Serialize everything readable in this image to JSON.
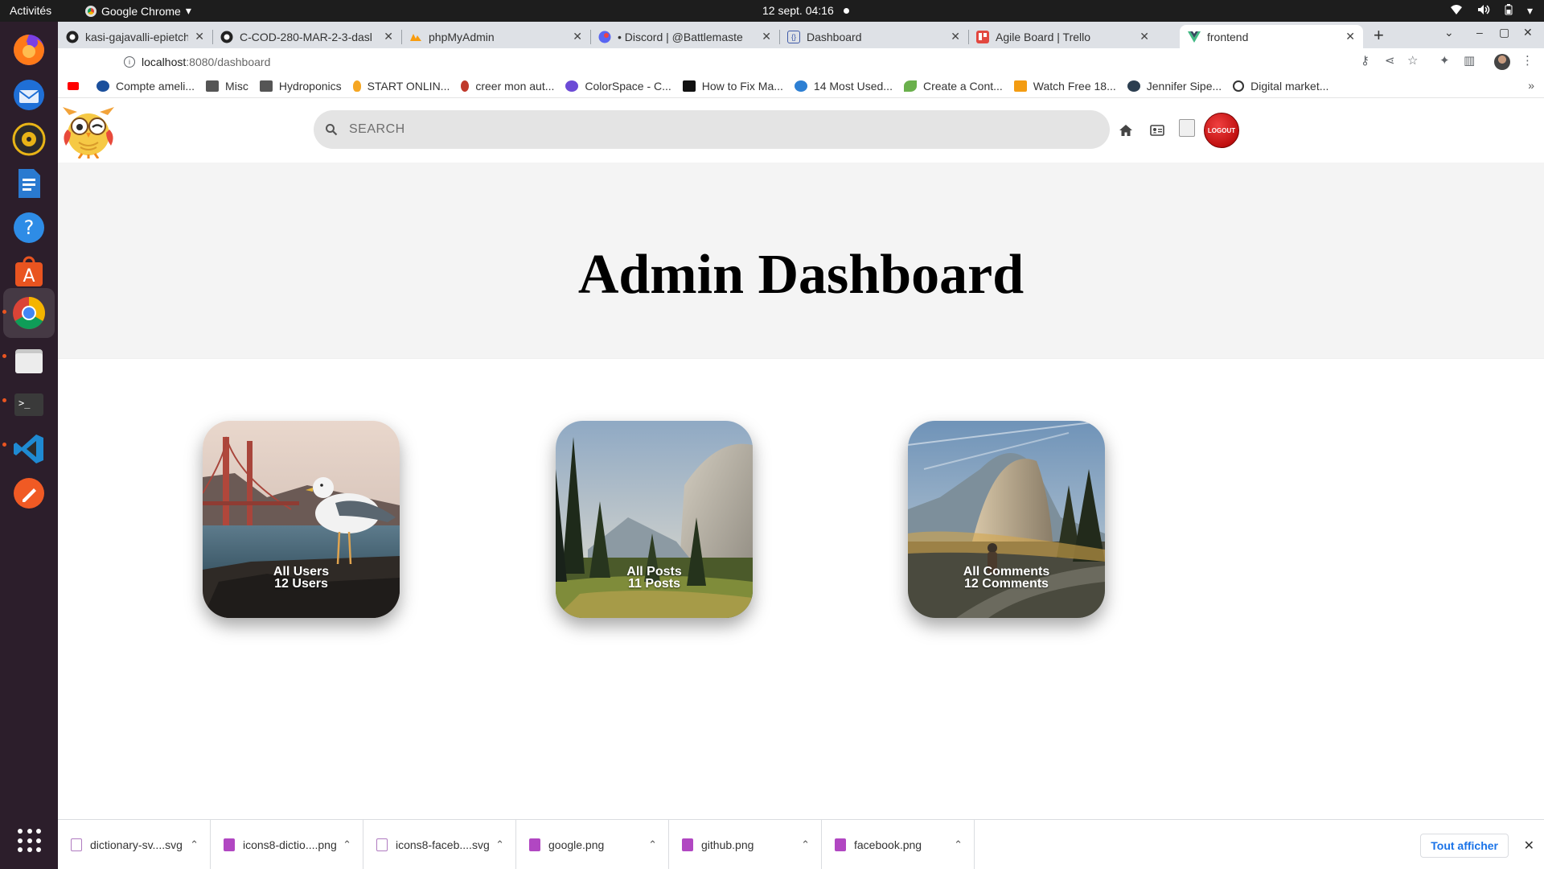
{
  "system": {
    "activities": "Activités",
    "app_menu": "Google Chrome",
    "clock": "12 sept.  04:16"
  },
  "browser": {
    "tabs": [
      {
        "title": "kasi-gajavalli-epietch/Yo",
        "icon": "github-icon"
      },
      {
        "title": "C-COD-280-MAR-2-3-dasl",
        "icon": "github-icon"
      },
      {
        "title": "phpMyAdmin",
        "icon": "phpmyadmin-icon"
      },
      {
        "title": "• Discord | @Battlemaste",
        "icon": "discord-icon"
      },
      {
        "title": "Dashboard",
        "icon": "vue-dashboard-icon"
      },
      {
        "title": "Agile Board | Trello",
        "icon": "trello-icon"
      },
      {
        "title": "frontend",
        "icon": "vue-icon"
      }
    ],
    "url_host": "localhost",
    "url_path": ":8080/dashboard",
    "bookmarks": [
      "Compte ameli...",
      "Misc",
      "Hydroponics",
      "START ONLIN...",
      "creer mon aut...",
      "ColorSpace - C...",
      "How to Fix Ma...",
      "14 Most Used...",
      "Create a Cont...",
      "Watch Free 18...",
      "Jennifer Sipe...",
      "Digital market..."
    ]
  },
  "app": {
    "search_placeholder": "SEARCH",
    "logout_label": "LOGOUT",
    "title": "Admin Dashboard",
    "cards": [
      {
        "title": "All Users",
        "count": "12 Users"
      },
      {
        "title": "All Posts",
        "count": "11 Posts"
      },
      {
        "title": "All Comments",
        "count": "12 Comments"
      }
    ]
  },
  "downloads": {
    "items": [
      {
        "name": "dictionary-sv....svg",
        "type": "svg"
      },
      {
        "name": "icons8-dictio....png",
        "type": "png"
      },
      {
        "name": "icons8-faceb....svg",
        "type": "svg"
      },
      {
        "name": "google.png",
        "type": "png"
      },
      {
        "name": "github.png",
        "type": "png"
      },
      {
        "name": "facebook.png",
        "type": "png"
      }
    ],
    "show_all": "Tout afficher"
  },
  "colors": {
    "logout": "#d01515",
    "search_bg": "#e4e4e4",
    "accent_link": "#1a73e8",
    "dock_bg": "#2c1e2b"
  }
}
